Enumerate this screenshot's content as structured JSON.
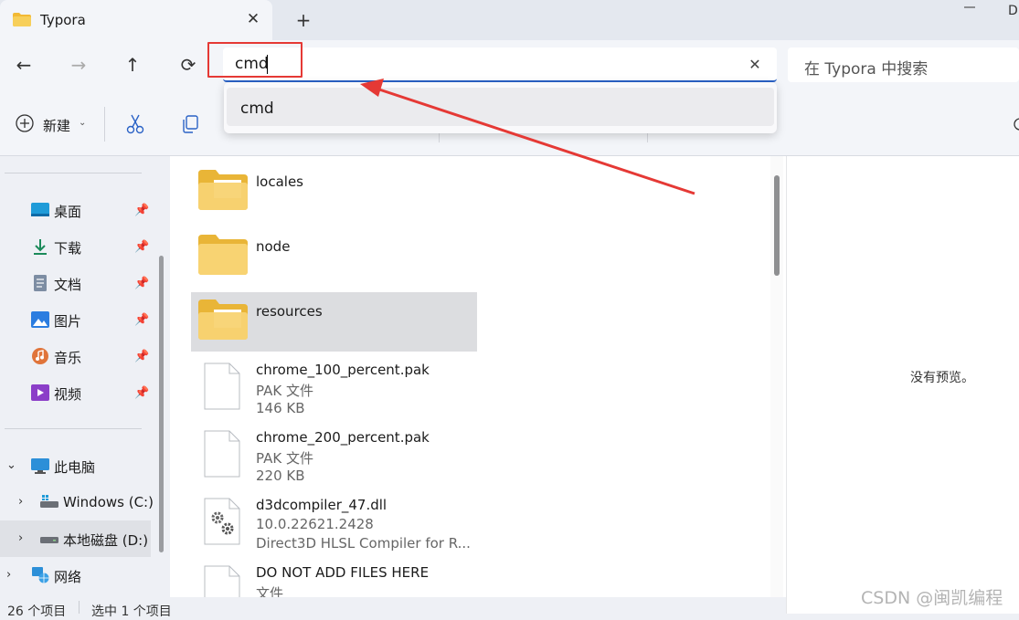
{
  "tab": {
    "title": "Typora",
    "close_icon": "close-icon",
    "new_tab_icon": "plus-icon"
  },
  "window": {
    "min_label": "",
    "extra": "D"
  },
  "nav": {
    "back": "←",
    "forward": "→",
    "up": "↑",
    "refresh": "⟳"
  },
  "address": {
    "value": "cmd",
    "clear": "✕"
  },
  "search": {
    "placeholder": "在 Typora 中搜索"
  },
  "toolbar": {
    "new_label": "新建",
    "chevron": "⌄"
  },
  "dropdown": {
    "items": [
      "cmd"
    ]
  },
  "sidebar": {
    "quick": [
      {
        "label": "桌面",
        "icon": "desktop-icon"
      },
      {
        "label": "下载",
        "icon": "download-icon"
      },
      {
        "label": "文档",
        "icon": "document-icon"
      },
      {
        "label": "图片",
        "icon": "picture-icon"
      },
      {
        "label": "音乐",
        "icon": "music-icon"
      },
      {
        "label": "视频",
        "icon": "video-icon"
      }
    ],
    "this_pc": "此电脑",
    "drive_c": "Windows (C:)",
    "drive_d": "本地磁盘 (D:)",
    "network": "网络"
  },
  "files": [
    {
      "name": "locales",
      "kind": "folder"
    },
    {
      "name": "node",
      "kind": "folder"
    },
    {
      "name": "resources",
      "kind": "folder"
    },
    {
      "name": "chrome_100_percent.pak",
      "type": "PAK 文件",
      "size": "146 KB"
    },
    {
      "name": "chrome_200_percent.pak",
      "type": "PAK 文件",
      "size": "220 KB"
    },
    {
      "name": "d3dcompiler_47.dll",
      "version": "10.0.22621.2428",
      "desc": "Direct3D HLSL Compiler for R..."
    },
    {
      "name": "DO NOT ADD FILES HERE",
      "type": "文件"
    }
  ],
  "preview": {
    "text": "没有预览。"
  },
  "status": {
    "count": "26 个项目",
    "selected": "选中 1 个项目"
  },
  "watermark": "CSDN @闽凯编程",
  "colors": {
    "accent": "#2a62c6",
    "annotation": "#e53935",
    "folder": "#f5c84c"
  }
}
